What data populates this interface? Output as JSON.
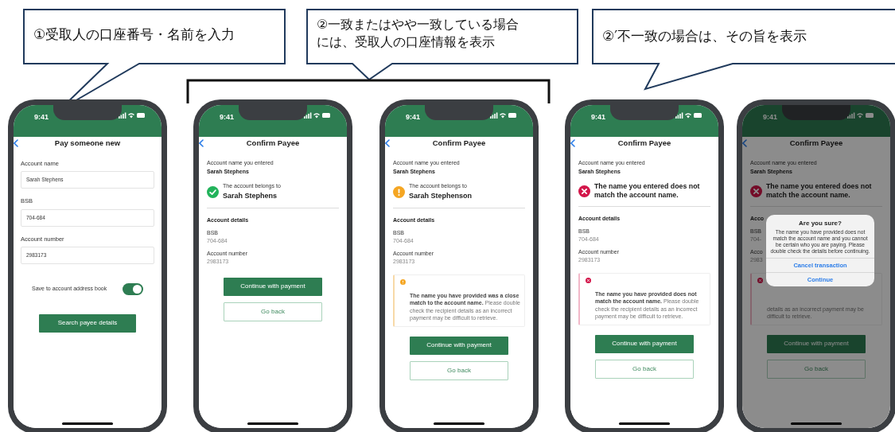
{
  "callouts": [
    {
      "text": "①受取人の口座番号・名前を入力"
    },
    {
      "text": "②一致またはやや一致している場合には、受取人の口座情報を表示"
    },
    {
      "text": "②′不一致の場合は、その旨を表示"
    }
  ],
  "phones": [
    {
      "kind": "form",
      "time": "9:41",
      "title": "Pay someone new",
      "fields": [
        {
          "label": "Account name",
          "value": "Sarah Stephens"
        },
        {
          "label": "BSB",
          "value": "704-684"
        },
        {
          "label": "Account number",
          "value": "2983173"
        }
      ],
      "toggle": {
        "label": "Save to account address book",
        "on": true
      },
      "button": "Search payee details"
    },
    {
      "kind": "confirm",
      "time": "9:41",
      "title": "Confirm Payee",
      "entered_label": "Account name you entered",
      "entered_name": "Sarah Stephens",
      "result": {
        "kind": "match",
        "caption": "The account belongs to",
        "name": "Sarah Stephens"
      },
      "details_heading": "Account details",
      "details": [
        {
          "label": "BSB",
          "value": "704-684"
        },
        {
          "label": "Account number",
          "value": "2983173"
        }
      ],
      "buttons": [
        "Continue with payment",
        "Go back"
      ]
    },
    {
      "kind": "confirm",
      "time": "9:41",
      "title": "Confirm Payee",
      "entered_label": "Account name you entered",
      "entered_name": "Sarah Stephens",
      "result": {
        "kind": "close",
        "caption": "The account belongs to",
        "name": "Sarah Stephenson"
      },
      "details_heading": "Account details",
      "details": [
        {
          "label": "BSB",
          "value": "704-684"
        },
        {
          "label": "Account number",
          "value": "2983173"
        }
      ],
      "alert": {
        "kind": "close",
        "text": "**The name you have provided was a close match to the account name.** Please double check the recipient details as an incorrect payment may be difficult to retrieve."
      },
      "buttons": [
        "Continue with payment",
        "Go back"
      ]
    },
    {
      "kind": "confirm",
      "time": "9:41",
      "title": "Confirm Payee",
      "entered_label": "Account name you entered",
      "entered_name": "Sarah Stephens",
      "result": {
        "kind": "mismatch",
        "message": "The name you entered does not match the account name."
      },
      "details_heading": "Account details",
      "details": [
        {
          "label": "BSB",
          "value": "704-684"
        },
        {
          "label": "Account number",
          "value": "2983173"
        }
      ],
      "alert": {
        "kind": "mismatch",
        "text": "**The name you have provided does not match the account name.** Please double check the recipient details as an incorrect payment may be difficult to retrieve."
      },
      "buttons": [
        "Continue with payment",
        "Go back"
      ]
    },
    {
      "kind": "confirm",
      "time": "9:41",
      "title": "Confirm Payee",
      "entered_label": "Account name you entered",
      "entered_name": "Sarah Stephens",
      "result": {
        "kind": "mismatch",
        "message": "The name you entered does not match the account name."
      },
      "details_heading": "Acco",
      "details": [
        {
          "label": "BSB",
          "value": "704-"
        },
        {
          "label": "Acco",
          "value": "2983"
        }
      ],
      "alert": {
        "kind": "mismatch",
        "text": "details as an incorrect payment may be difficult to retrieve."
      },
      "buttons": [
        "Continue with payment",
        "Go back"
      ],
      "dialog": {
        "title": "Are you sure?",
        "message": "The name you have provided does not match the account name and you cannot be certain who you are paying. Please double check the details before continuing.",
        "actions": [
          "Cancel transaction",
          "Continue"
        ]
      }
    }
  ]
}
